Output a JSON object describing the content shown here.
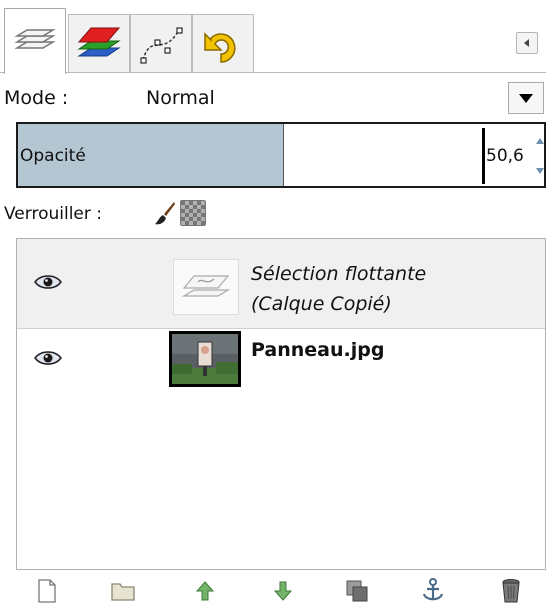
{
  "tabs": [
    {
      "icon": "layers-icon",
      "active": true
    },
    {
      "icon": "channels-icon",
      "active": false
    },
    {
      "icon": "paths-icon",
      "active": false
    },
    {
      "icon": "undo-history-icon",
      "active": false
    }
  ],
  "mode": {
    "label": "Mode :",
    "value": "Normal"
  },
  "opacity": {
    "label": "Opacité",
    "value": "50,6",
    "fraction": 0.506
  },
  "lock": {
    "label": "Verrouiller :"
  },
  "layers": [
    {
      "name_line1": "Sélection flottante",
      "name_line2": "(Calque Copié)",
      "visible": true
    },
    {
      "name": "Panneau.jpg",
      "visible": true
    }
  ],
  "toolbar": [
    "new-layer-icon",
    "new-group-icon",
    "raise-layer-icon",
    "lower-layer-icon",
    "duplicate-layer-icon",
    "anchor-layer-icon",
    "delete-layer-icon"
  ],
  "colors": {
    "accent": "#b5c6d3"
  }
}
